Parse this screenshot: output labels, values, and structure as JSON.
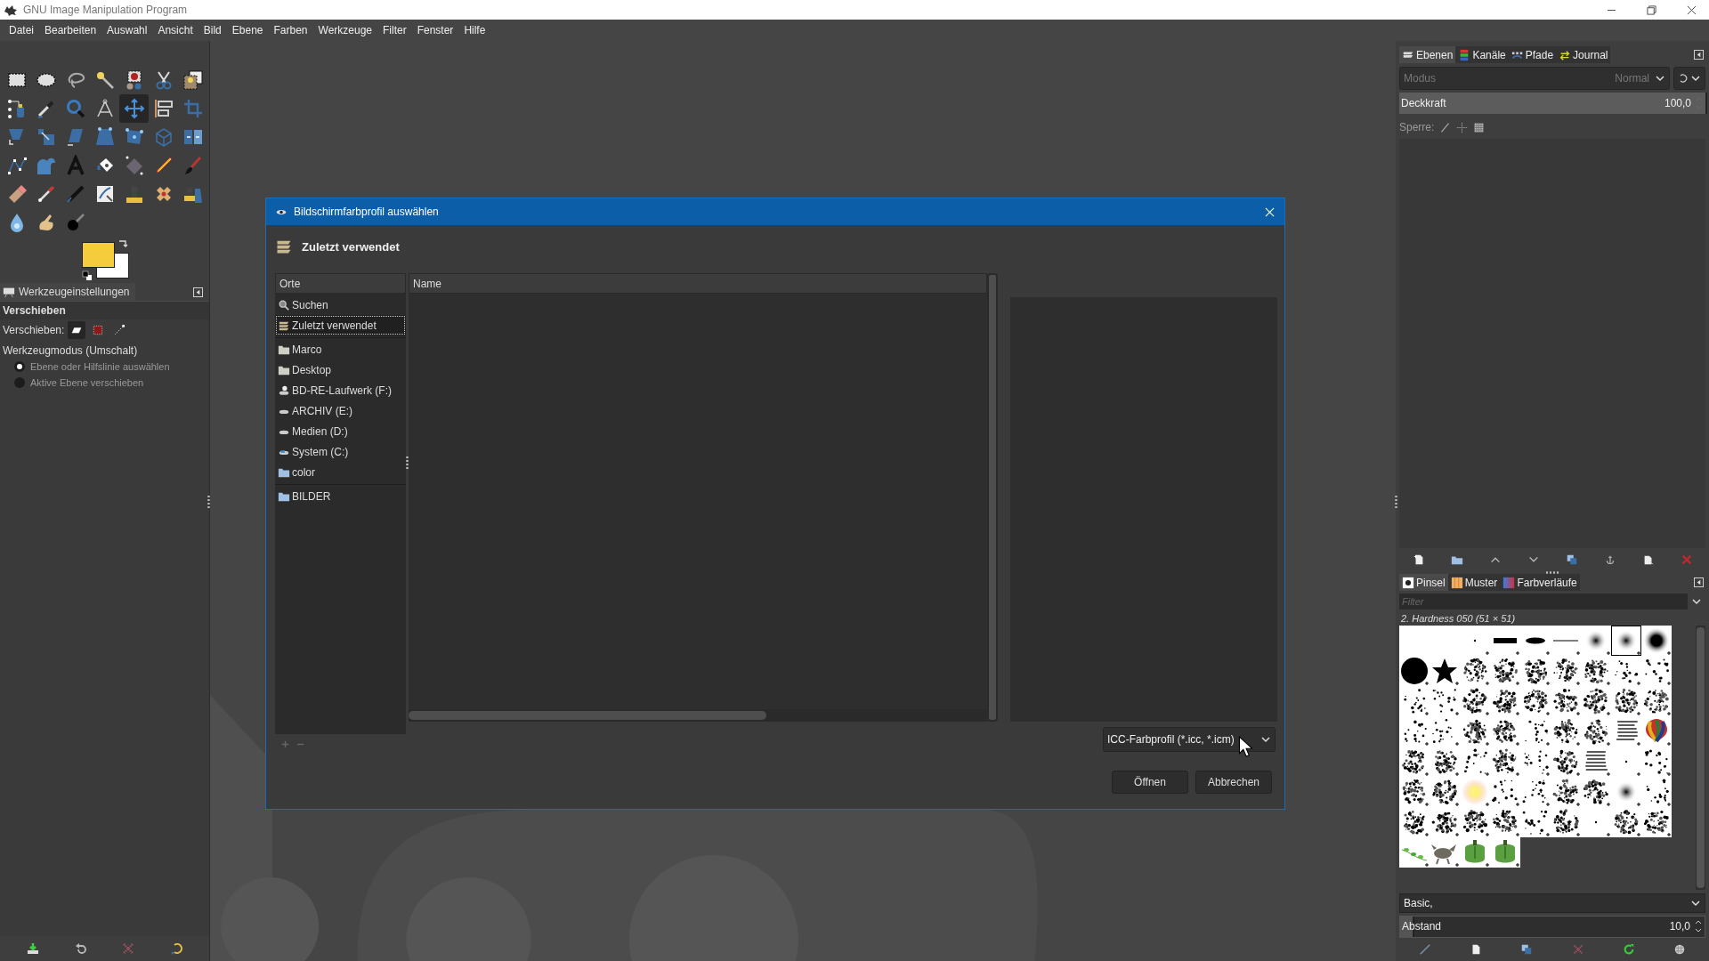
{
  "window": {
    "title": "GNU Image Manipulation Program"
  },
  "menu": [
    "Datei",
    "Bearbeiten",
    "Auswahl",
    "Ansicht",
    "Bild",
    "Ebene",
    "Farben",
    "Werkzeuge",
    "Filter",
    "Fenster",
    "Hilfe"
  ],
  "tools": [
    {
      "kind": "rect_select",
      "selected": false
    },
    {
      "kind": "ellipse_select",
      "selected": false
    },
    {
      "kind": "lasso",
      "selected": false
    },
    {
      "kind": "wand",
      "selected": false
    },
    {
      "kind": "color_select",
      "selected": false
    },
    {
      "kind": "scissors",
      "selected": false
    },
    {
      "kind": "fg_select",
      "selected": false
    },
    {
      "kind": "handle",
      "selected": false
    },
    {
      "kind": "picker",
      "selected": false
    },
    {
      "kind": "zoom",
      "selected": false
    },
    {
      "kind": "measure",
      "selected": false
    },
    {
      "kind": "move",
      "selected": true
    },
    {
      "kind": "align",
      "selected": false
    },
    {
      "kind": "crop",
      "selected": false
    },
    {
      "kind": "rotate",
      "selected": false
    },
    {
      "kind": "scale",
      "selected": false
    },
    {
      "kind": "shear",
      "selected": false
    },
    {
      "kind": "perspective",
      "selected": false
    },
    {
      "kind": "unified",
      "selected": false
    },
    {
      "kind": "cube",
      "selected": false
    },
    {
      "kind": "flip",
      "selected": false
    },
    {
      "kind": "paths",
      "selected": false
    },
    {
      "kind": "warp",
      "selected": false
    },
    {
      "kind": "text",
      "selected": false
    },
    {
      "kind": "bucket",
      "selected": false
    },
    {
      "kind": "gradient",
      "selected": false
    },
    {
      "kind": "pencil",
      "selected": false
    },
    {
      "kind": "paintbrush",
      "selected": false
    },
    {
      "kind": "eraser",
      "selected": false
    },
    {
      "kind": "airbrush",
      "selected": false
    },
    {
      "kind": "ink",
      "selected": false
    },
    {
      "kind": "mypaint",
      "selected": false
    },
    {
      "kind": "clone",
      "selected": false
    },
    {
      "kind": "heal",
      "selected": false
    },
    {
      "kind": "persp_clone",
      "selected": false
    },
    {
      "kind": "blur",
      "selected": false
    },
    {
      "kind": "smudge",
      "selected": false
    },
    {
      "kind": "dodge",
      "selected": false
    }
  ],
  "tool_options": {
    "tab": "Werkzeugeinstellungen",
    "title": "Verschieben",
    "move_label": "Verschieben:",
    "move_targets": [
      {
        "kind": "layer",
        "selected": true
      },
      {
        "kind": "selection",
        "selected": false
      },
      {
        "kind": "path",
        "selected": false
      }
    ],
    "mode_label": "Werkzeugmodus (Umschalt)",
    "modes": [
      {
        "label": "Ebene oder Hilfslinie auswählen",
        "checked": true
      },
      {
        "label": "Aktive Ebene verschieben",
        "checked": false
      }
    ]
  },
  "dialog": {
    "title": "Bildschirmfarbprofil auswählen",
    "location": "Zuletzt verwendet",
    "places_header": "Orte",
    "places": [
      [
        {
          "kind": "search",
          "label": "Suchen",
          "selected": false
        },
        {
          "kind": "recent",
          "label": "Zuletzt verwendet",
          "selected": true
        }
      ],
      [
        {
          "kind": "folder",
          "label": "Marco",
          "selected": false
        },
        {
          "kind": "folder",
          "label": "Desktop",
          "selected": false
        },
        {
          "kind": "optical",
          "label": "BD-RE-Laufwerk (F:)",
          "selected": false
        },
        {
          "kind": "drive",
          "label": "ARCHIV (E:)",
          "selected": false
        },
        {
          "kind": "drive",
          "label": "Medien (D:)",
          "selected": false
        },
        {
          "kind": "system",
          "label": "System (C:)",
          "selected": false
        },
        {
          "kind": "bookmark",
          "label": "color",
          "selected": false
        }
      ],
      [
        {
          "kind": "bookmark",
          "label": "BILDER",
          "selected": false
        }
      ]
    ],
    "name_header": "Name",
    "filter": "ICC-Farbprofil (*.icc, *.icm)",
    "buttons": [
      "Öffnen",
      "Abbrechen"
    ]
  },
  "layers_dock": {
    "tabs": [
      {
        "kind": "layers",
        "label": "Ebenen",
        "selected": true
      },
      {
        "kind": "channels",
        "label": "Kanäle",
        "selected": false
      },
      {
        "kind": "paths",
        "label": "Pfade",
        "selected": false
      },
      {
        "kind": "history",
        "label": "Journal",
        "selected": false
      }
    ],
    "mode_label": "Modus",
    "mode_value": "Normal",
    "opacity_label": "Deckkraft",
    "opacity": {
      "level": 1,
      "reading": "100,0"
    },
    "lock_label": "Sperre:"
  },
  "brushes_dock": {
    "tabs": [
      {
        "kind": "brushes",
        "label": "Pinsel",
        "selected": true
      },
      {
        "kind": "patterns",
        "label": "Muster",
        "selected": false
      },
      {
        "kind": "gradients",
        "label": "Farbverläufe",
        "selected": false
      }
    ],
    "filter_placeholder": "Filter",
    "brush_name": "2. Hardness 050 (51 × 51)",
    "brushes": [
      {
        "kind": "blank",
        "selected": false
      },
      {
        "kind": "blank",
        "selected": false
      },
      {
        "kind": "point",
        "selected": false
      },
      {
        "kind": "bar",
        "selected": false
      },
      {
        "kind": "ellipse",
        "selected": false
      },
      {
        "kind": "line",
        "selected": false
      },
      {
        "kind": "soft",
        "selected": false
      },
      {
        "kind": "soft",
        "selected": true
      },
      {
        "kind": "softbig",
        "selected": false
      },
      {
        "kind": "disc",
        "selected": false
      },
      {
        "kind": "star",
        "selected": false
      },
      {
        "kind": "texture",
        "selected": false
      },
      {
        "kind": "texture",
        "selected": false
      },
      {
        "kind": "texture",
        "selected": false
      },
      {
        "kind": "texture",
        "selected": false
      },
      {
        "kind": "texture",
        "selected": false
      },
      {
        "kind": "sparse",
        "selected": false
      },
      {
        "kind": "sparse",
        "selected": false
      },
      {
        "kind": "sparse",
        "selected": false
      },
      {
        "kind": "sparse",
        "selected": false
      },
      {
        "kind": "texture",
        "selected": false
      },
      {
        "kind": "texture",
        "selected": false
      },
      {
        "kind": "texture",
        "selected": false
      },
      {
        "kind": "texture",
        "selected": false
      },
      {
        "kind": "texture",
        "selected": false
      },
      {
        "kind": "texture",
        "selected": false
      },
      {
        "kind": "texture",
        "selected": false
      },
      {
        "kind": "sparse",
        "selected": false
      },
      {
        "kind": "sparse",
        "selected": false
      },
      {
        "kind": "texture",
        "selected": false
      },
      {
        "kind": "texture",
        "selected": false
      },
      {
        "kind": "sparse",
        "selected": false
      },
      {
        "kind": "texture",
        "selected": false
      },
      {
        "kind": "texture",
        "selected": false
      },
      {
        "kind": "lines",
        "selected": false
      },
      {
        "kind": "balloon",
        "selected": false
      },
      {
        "kind": "texture",
        "selected": false
      },
      {
        "kind": "texture",
        "selected": false
      },
      {
        "kind": "sparse",
        "selected": false
      },
      {
        "kind": "texture",
        "selected": false
      },
      {
        "kind": "sparse",
        "selected": false
      },
      {
        "kind": "texture",
        "selected": false
      },
      {
        "kind": "lines",
        "selected": false
      },
      {
        "kind": "point",
        "selected": false
      },
      {
        "kind": "sparse",
        "selected": false
      },
      {
        "kind": "texture",
        "selected": false
      },
      {
        "kind": "texture",
        "selected": false
      },
      {
        "kind": "glow",
        "selected": false
      },
      {
        "kind": "sparse",
        "selected": false
      },
      {
        "kind": "sparse",
        "selected": false
      },
      {
        "kind": "texture",
        "selected": false
      },
      {
        "kind": "texture",
        "selected": false
      },
      {
        "kind": "soft",
        "selected": false
      },
      {
        "kind": "sparse",
        "selected": false
      },
      {
        "kind": "texture",
        "selected": false
      },
      {
        "kind": "texture",
        "selected": false
      },
      {
        "kind": "texture",
        "selected": false
      },
      {
        "kind": "texture",
        "selected": false
      },
      {
        "kind": "sparse",
        "selected": false
      },
      {
        "kind": "texture",
        "selected": false
      },
      {
        "kind": "point",
        "selected": false
      },
      {
        "kind": "texture",
        "selected": false
      },
      {
        "kind": "texture",
        "selected": false
      },
      {
        "kind": "ivy",
        "selected": false
      },
      {
        "kind": "creature",
        "selected": false
      },
      {
        "kind": "pepper",
        "selected": false
      },
      {
        "kind": "pepper",
        "selected": false
      }
    ],
    "tag": "Basic,",
    "spacing_label": "Abstand",
    "spacing": {
      "level": 0.04,
      "reading": "10,0"
    }
  }
}
